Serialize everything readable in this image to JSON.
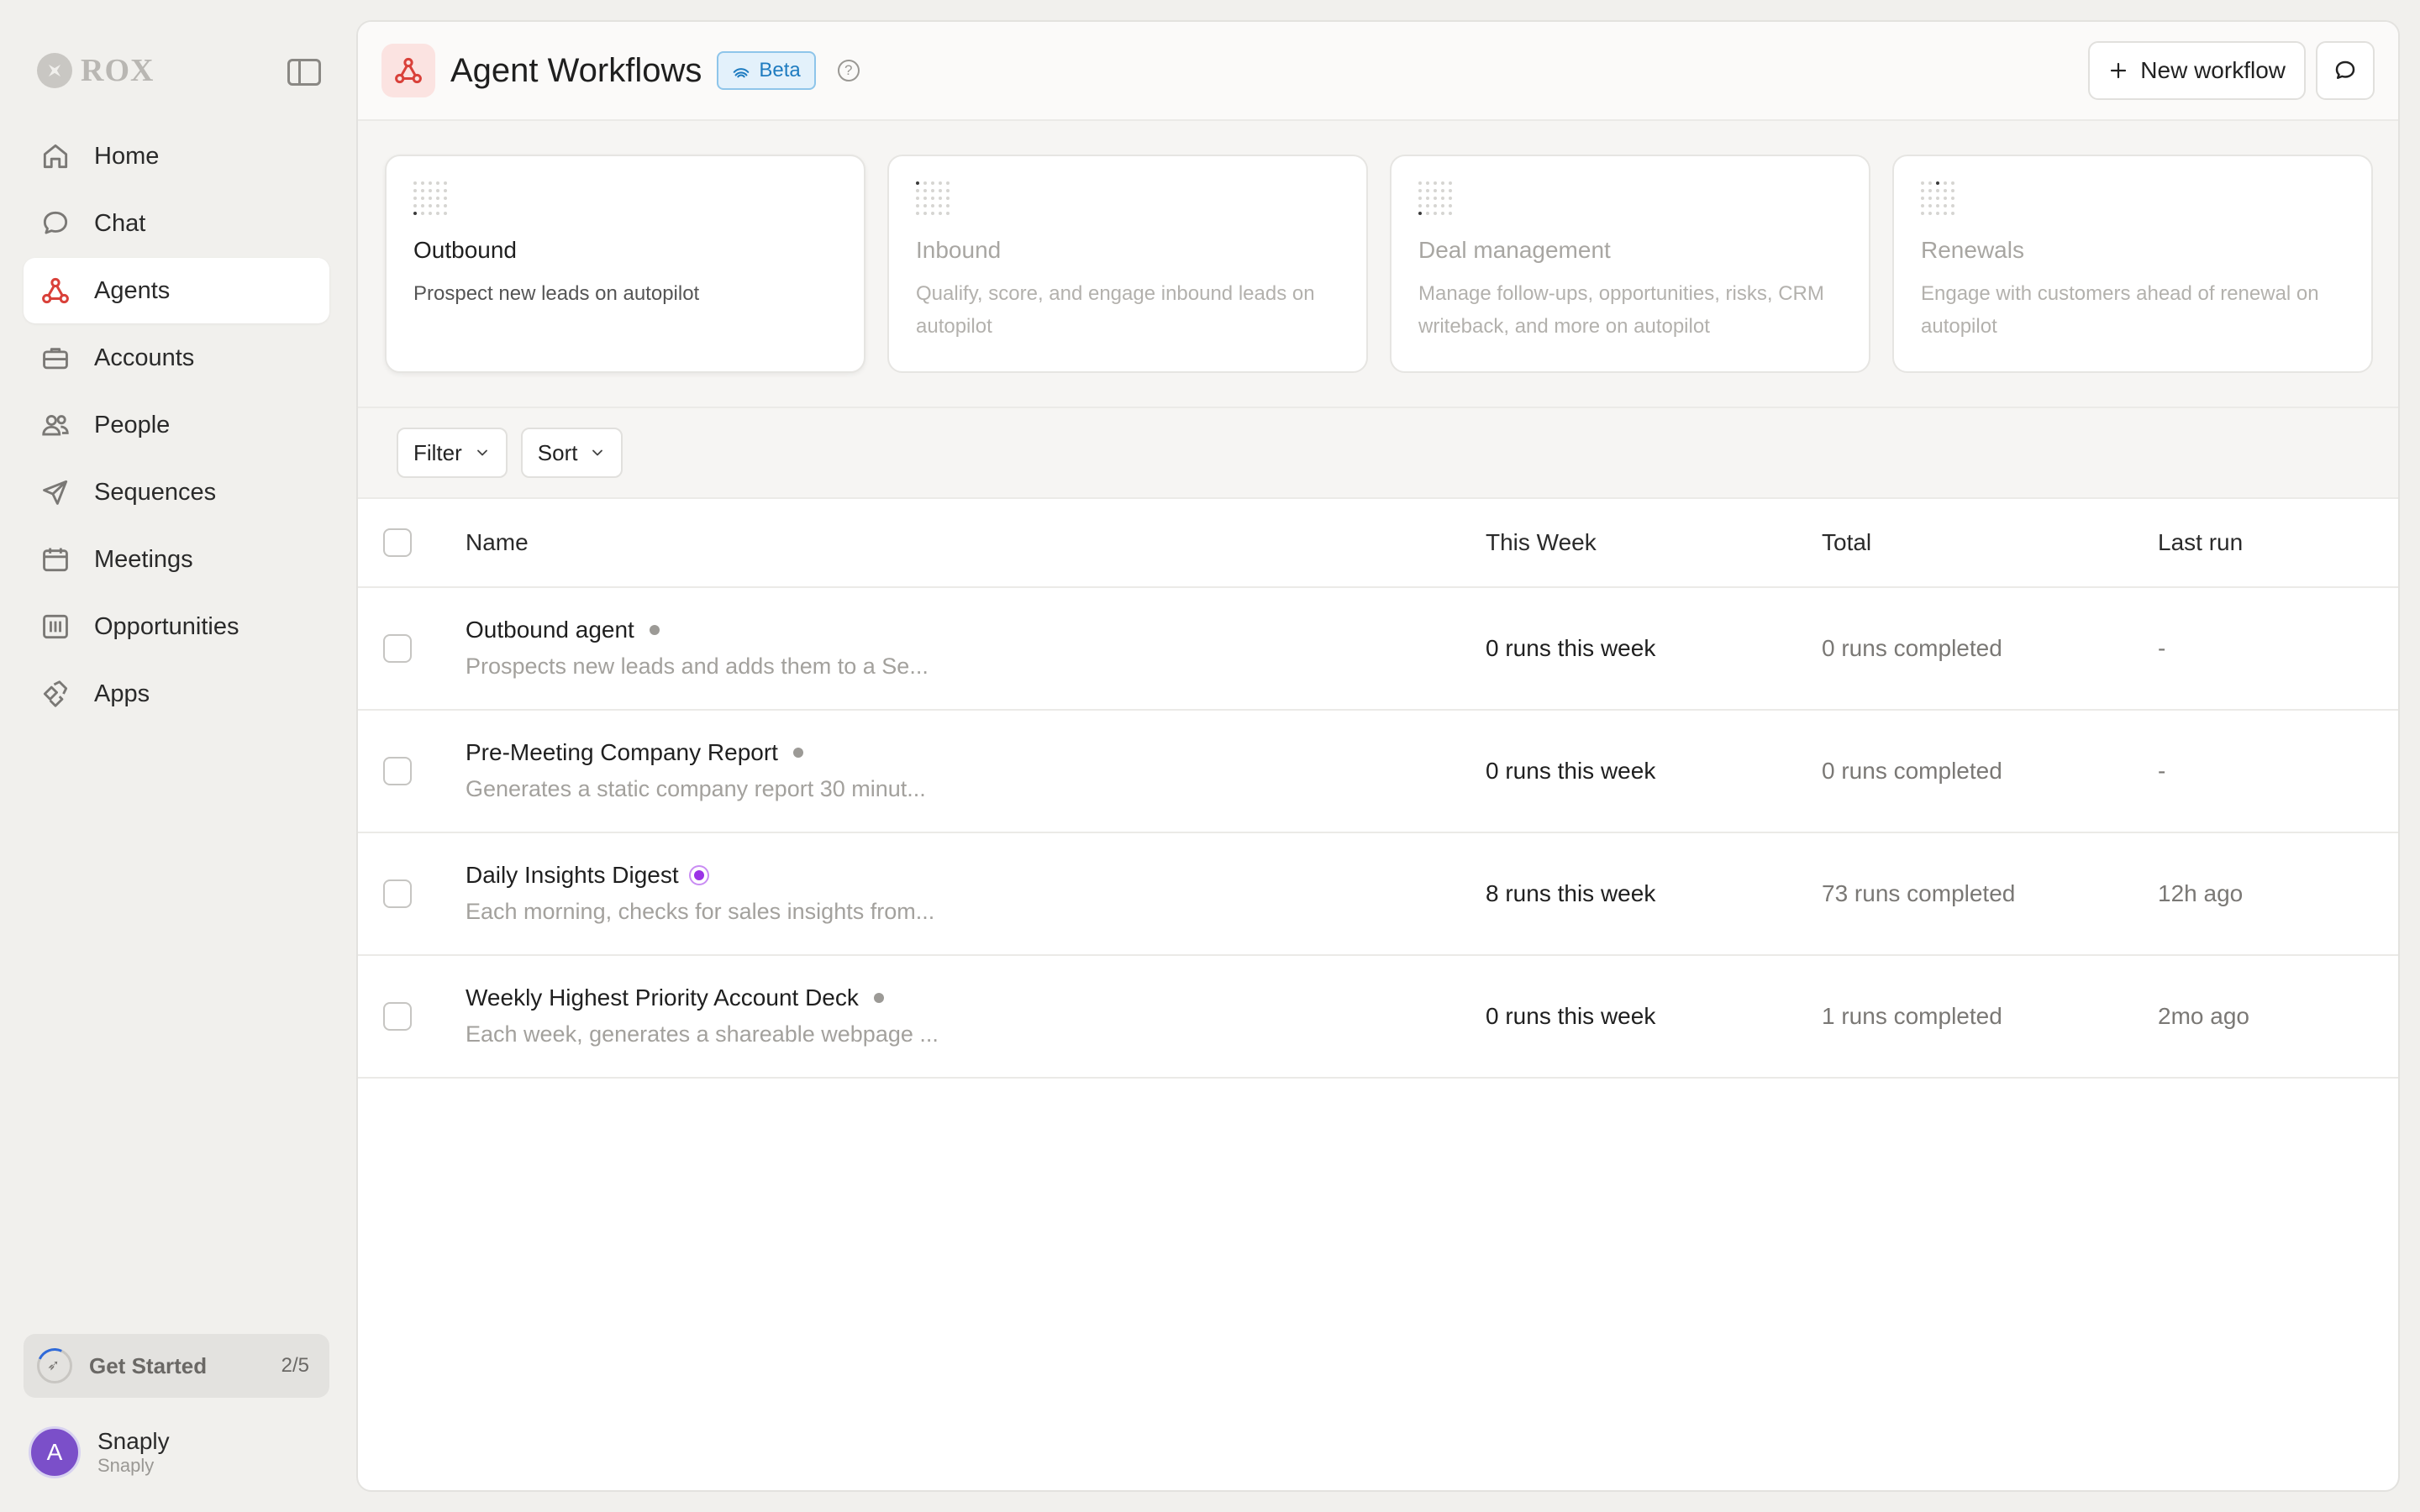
{
  "brand": "ROX",
  "sidebar": {
    "items": [
      {
        "label": "Home",
        "icon": "home-icon"
      },
      {
        "label": "Chat",
        "icon": "chat-icon"
      },
      {
        "label": "Agents",
        "icon": "agents-icon",
        "active": true
      },
      {
        "label": "Accounts",
        "icon": "briefcase-icon"
      },
      {
        "label": "People",
        "icon": "people-icon"
      },
      {
        "label": "Sequences",
        "icon": "send-icon"
      },
      {
        "label": "Meetings",
        "icon": "calendar-icon"
      },
      {
        "label": "Opportunities",
        "icon": "opportunities-icon"
      },
      {
        "label": "Apps",
        "icon": "apps-icon"
      }
    ],
    "get_started": {
      "label": "Get Started",
      "count": "2/5",
      "progress": 0.4
    },
    "user": {
      "initial": "A",
      "name": "Snaply",
      "org": "Snaply"
    }
  },
  "header": {
    "title": "Agent Workflows",
    "badge": "Beta",
    "help": "?",
    "new_button": "New workflow"
  },
  "cards": [
    {
      "title": "Outbound",
      "desc": "Prospect new leads on autopilot",
      "active": true
    },
    {
      "title": "Inbound",
      "desc": "Qualify, score, and engage inbound leads on autopilot"
    },
    {
      "title": "Deal management",
      "desc": "Manage follow-ups, opportunities, risks, CRM writeback, and more on autopilot"
    },
    {
      "title": "Renewals",
      "desc": "Engage with customers ahead of renewal on autopilot"
    }
  ],
  "toolbar": {
    "filter": "Filter",
    "sort": "Sort"
  },
  "table": {
    "columns": [
      "Name",
      "This Week",
      "Total",
      "Last run"
    ],
    "rows": [
      {
        "name": "Outbound agent",
        "desc": "Prospects new leads and adds them to a Se...",
        "status": "idle",
        "week": "0 runs this week",
        "total": "0 runs completed",
        "last": "-"
      },
      {
        "name": "Pre-Meeting Company Report",
        "desc": "Generates a static company report 30 minut...",
        "status": "idle",
        "week": "0 runs this week",
        "total": "0 runs completed",
        "last": "-"
      },
      {
        "name": "Daily Insights Digest",
        "desc": "Each morning, checks for sales insights from...",
        "status": "active",
        "week": "8 runs this week",
        "total": "73 runs completed",
        "last": "12h ago"
      },
      {
        "name": "Weekly Highest Priority Account Deck",
        "desc": "Each week, generates a shareable webpage ...",
        "status": "idle",
        "week": "0 runs this week",
        "total": "1 runs completed",
        "last": "2mo ago"
      }
    ]
  },
  "colors": {
    "accent": "#d9413a",
    "beta": "#1f7cc0",
    "live": "#9b32e6"
  }
}
